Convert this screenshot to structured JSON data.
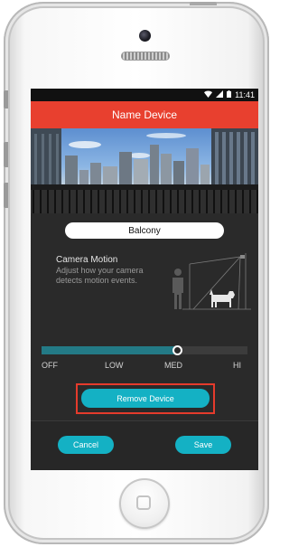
{
  "status_bar": {
    "time": "11:41",
    "icons": [
      "wifi-icon",
      "cellular-signal-icon",
      "battery-icon"
    ]
  },
  "header": {
    "title": "Name Device"
  },
  "camera_preview": {
    "description": "balcony-city-view"
  },
  "device_name": {
    "value": "Balcony"
  },
  "camera_motion": {
    "title": "Camera Motion",
    "description": "Adjust how your camera detects motion events.",
    "level_fraction": 0.66,
    "levels": [
      "OFF",
      "LOW",
      "MED",
      "HI"
    ],
    "selected_level": "MED"
  },
  "actions": {
    "remove_label": "Remove Device",
    "cancel_label": "Cancel",
    "save_label": "Save"
  },
  "colors": {
    "header": "#e8402f",
    "accent": "#14b1c4",
    "slider_fill": "#237a86",
    "highlight": "#e53b2c",
    "screen_bg": "#2a2a2a"
  }
}
